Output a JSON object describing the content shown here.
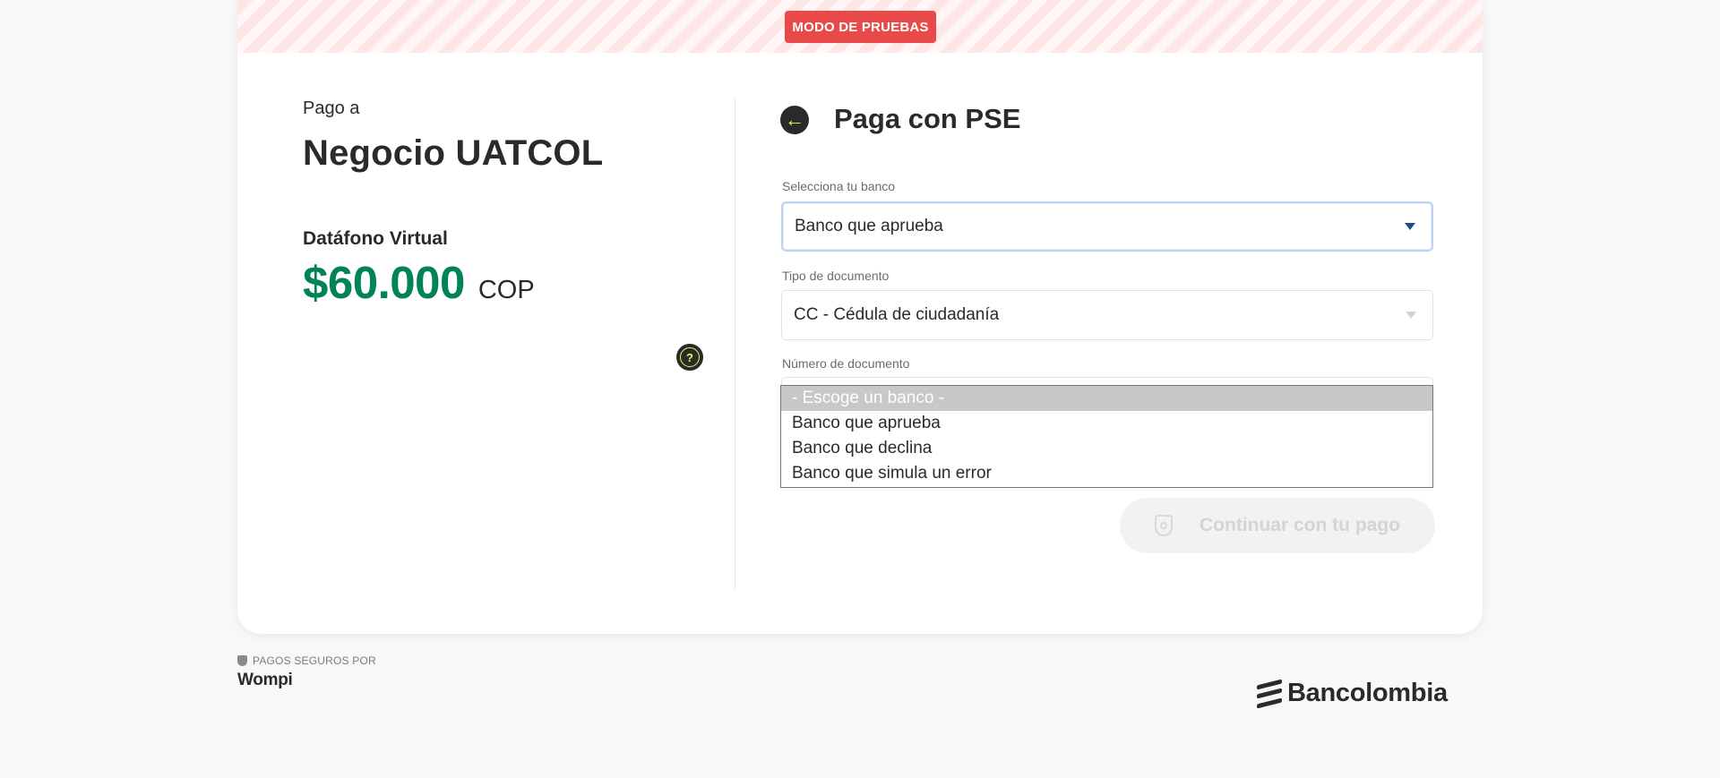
{
  "banner": {
    "badge": "MODO DE PRUEBAS"
  },
  "summary": {
    "pay_to_label": "Pago a",
    "merchant_name": "Negocio UATCOL",
    "product_name": "Datáfono Virtual",
    "amount": "$60.000",
    "currency": "COP",
    "help_icon_glyph": "?"
  },
  "payment": {
    "back_icon_glyph": "←",
    "title": "Paga con PSE",
    "bank_field": {
      "label": "Selecciona tu banco",
      "value": "Banco que aprueba"
    },
    "doc_type_field": {
      "label": "Tipo de documento",
      "value": "CC - Cédula de ciudadanía"
    },
    "doc_number_field": {
      "label": "Número de documento"
    },
    "bank_options": [
      "- Escoge un banco -",
      "Banco que aprueba",
      "Banco que declina",
      "Banco que simula un error"
    ],
    "continue_label": "Continuar con tu pago"
  },
  "footer": {
    "secure_text": "PAGOS SEGUROS POR",
    "wompi": "Wompi",
    "bank_brand": "Bancolombia"
  },
  "colors": {
    "accent_green": "#00825a",
    "badge_red": "#e84a4a",
    "lime": "#dfff61"
  }
}
